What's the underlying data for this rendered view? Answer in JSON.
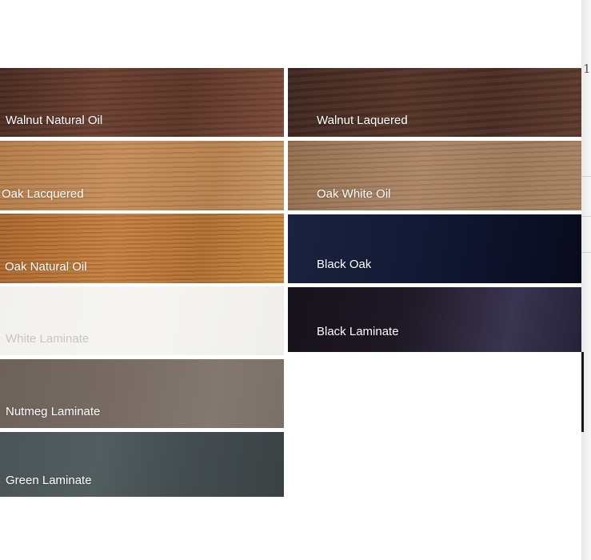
{
  "swatches": {
    "left": [
      {
        "label": "Walnut Natural Oil",
        "color": "#5e3a2b"
      },
      {
        "label": "Oak Lacquered",
        "color": "#bd8553"
      },
      {
        "label": "Oak Natural Oil",
        "color": "#b87636"
      },
      {
        "label": "White Laminate",
        "color": "#f4f3f0"
      },
      {
        "label": "Nutmeg Laminate",
        "color": "#776c64"
      },
      {
        "label": "Green Laminate",
        "color": "#4a5457"
      }
    ],
    "right": [
      {
        "label": "Walnut Laquered",
        "color": "#4e2f25"
      },
      {
        "label": "Oak White Oil",
        "color": "#a07b5b"
      },
      {
        "label": "Black Oak",
        "color": "#131a33"
      },
      {
        "label": "Black Laminate",
        "color": "#221b2a"
      }
    ]
  },
  "edge": {
    "mark": "1"
  }
}
